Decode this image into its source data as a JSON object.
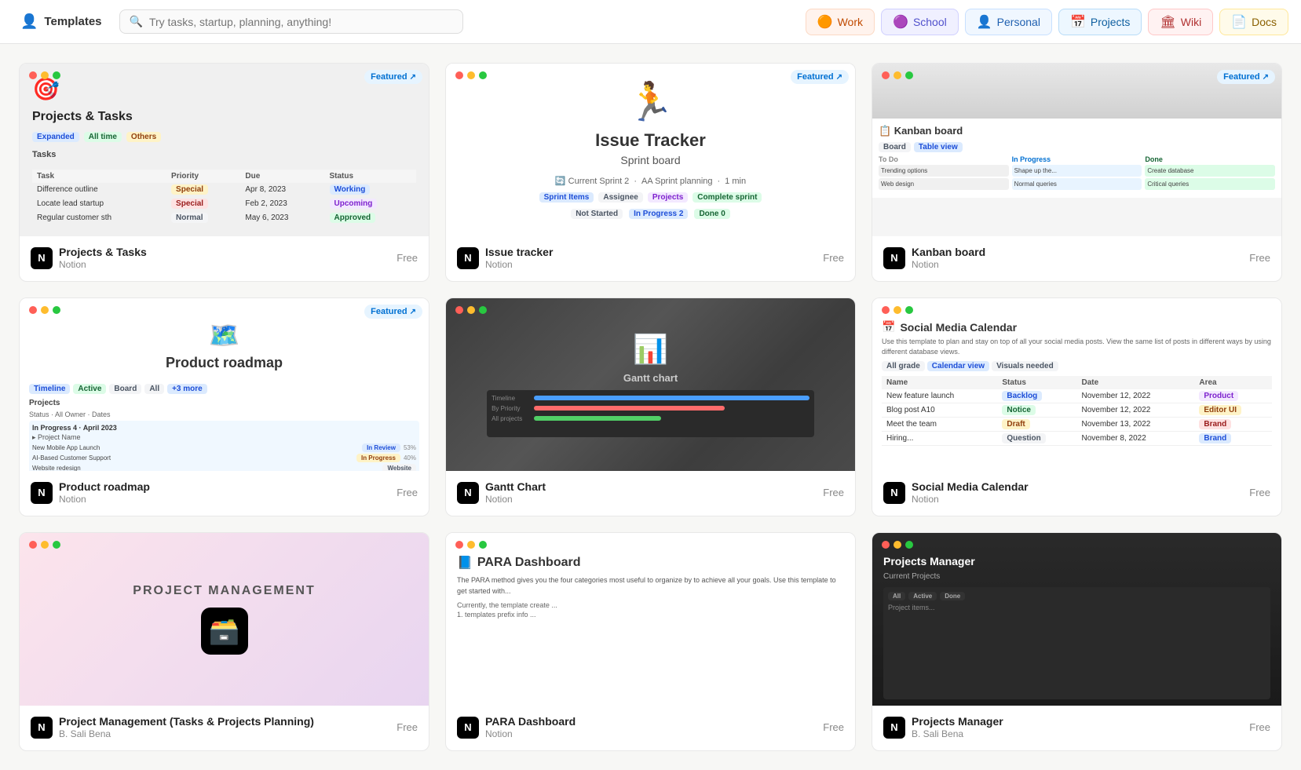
{
  "header": {
    "logo_label": "Templates",
    "logo_icon": "👤",
    "search_placeholder": "Try tasks, startup, planning, anything!",
    "nav": [
      {
        "key": "work",
        "label": "Work",
        "emoji": "🟠",
        "class": "work"
      },
      {
        "key": "school",
        "label": "School",
        "emoji": "🟣",
        "class": "school"
      },
      {
        "key": "personal",
        "label": "Personal",
        "emoji": "👤",
        "class": "personal"
      },
      {
        "key": "projects",
        "label": "Projects",
        "emoji": "📅",
        "class": "projects"
      },
      {
        "key": "wiki",
        "label": "Wiki",
        "emoji": "🏛",
        "class": "wiki"
      },
      {
        "key": "docs",
        "label": "Docs",
        "emoji": "📄",
        "class": "docs"
      }
    ]
  },
  "cards": [
    {
      "id": "projects-tasks",
      "title": "Projects & Tasks",
      "author": "Notion",
      "price": "Free",
      "featured": true,
      "preview_type": "projects-tasks"
    },
    {
      "id": "issue-tracker",
      "title": "Issue tracker",
      "author": "Notion",
      "price": "Free",
      "featured": true,
      "preview_type": "issue-tracker"
    },
    {
      "id": "kanban-board",
      "title": "Kanban board",
      "author": "Notion",
      "price": "Free",
      "featured": true,
      "preview_type": "kanban-board"
    },
    {
      "id": "product-roadmap",
      "title": "Product roadmap",
      "author": "Notion",
      "price": "Free",
      "featured": true,
      "preview_type": "product-roadmap"
    },
    {
      "id": "gantt-chart",
      "title": "Gantt Chart",
      "author": "Notion",
      "price": "Free",
      "featured": false,
      "preview_type": "gantt-chart"
    },
    {
      "id": "social-media-calendar",
      "title": "Social Media Calendar",
      "author": "Notion",
      "price": "Free",
      "featured": false,
      "preview_type": "social-media"
    },
    {
      "id": "project-management",
      "title": "Project Management (Tasks & Projects Planning)",
      "author": "B. Sali Bena",
      "price": "Free",
      "featured": false,
      "preview_type": "project-management"
    },
    {
      "id": "para-dashboard",
      "title": "PARA Dashboard",
      "author": "Notion",
      "price": "Free",
      "featured": false,
      "preview_type": "para-dashboard"
    },
    {
      "id": "projects-manager",
      "title": "Projects Manager",
      "author": "B. Sali Bena",
      "price": "Free",
      "featured": false,
      "preview_type": "projects-manager"
    }
  ],
  "labels": {
    "featured": "Featured",
    "free": "Free",
    "notion": "Notion"
  }
}
